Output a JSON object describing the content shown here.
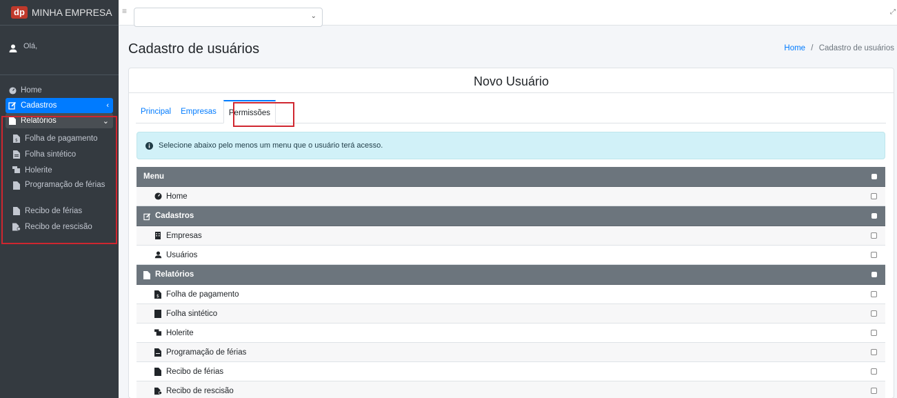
{
  "brand": {
    "logo": "dp",
    "name": "MINHA EMPRESA"
  },
  "user": {
    "greeting": "Olá,"
  },
  "sidebar": {
    "items": [
      {
        "label": "Home",
        "icon": "dashboard-icon"
      },
      {
        "label": "Cadastros",
        "icon": "edit-icon",
        "caret": "‹"
      },
      {
        "label": "Relatórios",
        "icon": "file-icon",
        "caret": "⌄"
      }
    ],
    "subitems": [
      {
        "label": "Folha de pagamento",
        "icon": "file-invoice-icon"
      },
      {
        "label": "Folha sintético",
        "icon": "file-alt-icon"
      },
      {
        "label": "Holerite",
        "icon": "receipt-icon"
      },
      {
        "label": "Programação de férias",
        "icon": "file-icon"
      },
      {
        "label": "Recibo de férias",
        "icon": "file-icon"
      },
      {
        "label": "Recibo de rescisão",
        "icon": "file-signature-icon"
      }
    ]
  },
  "page": {
    "title": "Cadastro de usuários"
  },
  "breadcrumb": {
    "home": "Home",
    "separator": "/",
    "current": "Cadastro de usuários"
  },
  "card": {
    "title": "Novo Usuário"
  },
  "tabs": [
    {
      "label": "Principal"
    },
    {
      "label": "Empresas"
    },
    {
      "label": "Permissões"
    }
  ],
  "alert": {
    "text": "Selecione abaixo pelo menos um menu que o usuário terá acesso."
  },
  "permissions": {
    "rows": [
      {
        "type": "header",
        "label": "Menu"
      },
      {
        "type": "child",
        "label": "Home",
        "icon": "dashboard-icon"
      },
      {
        "type": "header",
        "label": "Cadastros",
        "icon": "edit-icon"
      },
      {
        "type": "child",
        "label": "Empresas",
        "icon": "building-icon"
      },
      {
        "type": "child",
        "label": "Usuários",
        "icon": "user-icon"
      },
      {
        "type": "header",
        "label": "Relatórios",
        "icon": "file-icon"
      },
      {
        "type": "child",
        "label": "Folha de pagamento",
        "icon": "file-invoice-icon"
      },
      {
        "type": "child",
        "label": "Folha sintético",
        "icon": "file-alt-icon"
      },
      {
        "type": "child",
        "label": "Holerite",
        "icon": "receipt-icon"
      },
      {
        "type": "child",
        "label": "Programação de férias",
        "icon": "file-icon"
      },
      {
        "type": "child",
        "label": "Recibo de férias",
        "icon": "file-icon"
      },
      {
        "type": "child",
        "label": "Recibo de rescisão",
        "icon": "file-signature-icon"
      }
    ]
  },
  "colors": {
    "sidebar_bg": "#343a40",
    "active": "#007bff",
    "header_row": "#6c757d",
    "alert_bg": "#d1f1f8",
    "highlight": "#d0262f"
  }
}
